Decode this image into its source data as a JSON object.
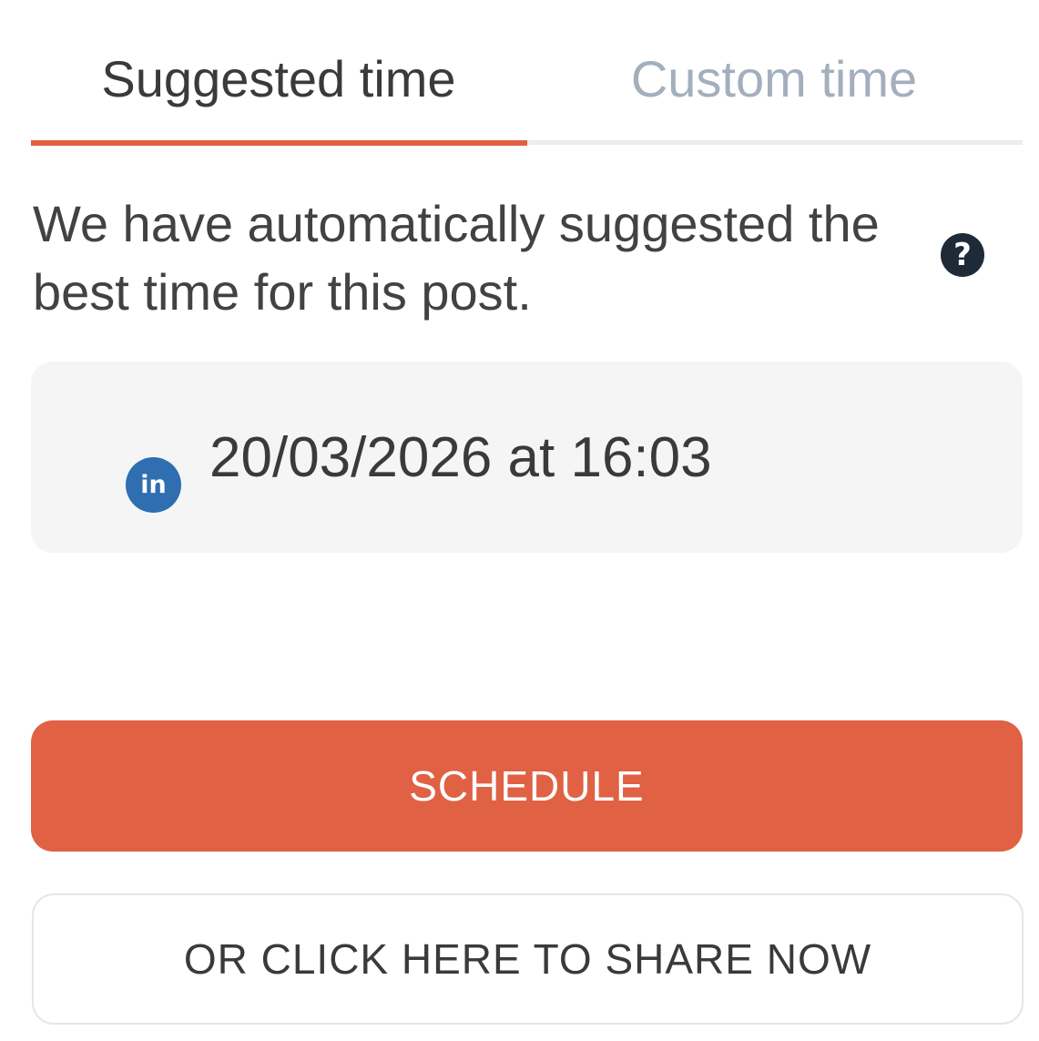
{
  "tabs": {
    "suggested_label": "Suggested time",
    "custom_label": "Custom time",
    "active_tab": "Suggested time"
  },
  "intro": {
    "text": "We have automatically suggested the best time for this post."
  },
  "help": {
    "icon": "question-circle-icon",
    "glyph": "?"
  },
  "scheduled": {
    "network_icon": "linkedin-icon",
    "network_glyph": "in",
    "time_text": "20/03/2026 at 16:03"
  },
  "actions": {
    "schedule_label": "SCHEDULE",
    "share_now_label": "OR CLICK HERE TO SHARE NOW"
  },
  "colors": {
    "accent": "#e06143",
    "active_tab_text": "#3a3a3a",
    "inactive_tab_text": "#a3afbd",
    "linkedin": "#2f6eb0",
    "card_background": "#f5f5f5",
    "help_icon": "#1f2a38"
  }
}
